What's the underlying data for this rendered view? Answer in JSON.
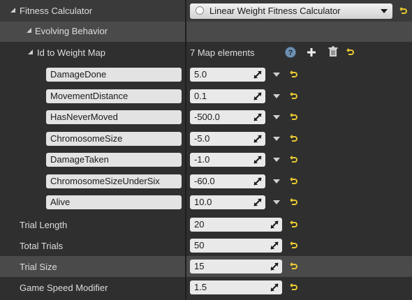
{
  "fitness_calculator": {
    "label": "Fitness Calculator",
    "selected_value": "Linear Weight Fitness Calculator"
  },
  "evolving_behavior": {
    "label": "Evolving Behavior"
  },
  "weight_map": {
    "label": "Id to Weight Map",
    "count_text": "7 Map elements",
    "entries": [
      {
        "key": "DamageDone",
        "value": "5.0"
      },
      {
        "key": "MovementDistance",
        "value": "0.1"
      },
      {
        "key": "HasNeverMoved",
        "value": "-500.0"
      },
      {
        "key": "ChromosomeSize",
        "value": "-5.0"
      },
      {
        "key": "DamageTaken",
        "value": "-1.0"
      },
      {
        "key": "ChromosomeSizeUnderSix",
        "value": "-60.0"
      },
      {
        "key": "Alive",
        "value": "10.0"
      }
    ]
  },
  "properties": [
    {
      "label": "Trial Length",
      "value": "20"
    },
    {
      "label": "Total Trials",
      "value": "50"
    },
    {
      "label": "Trial Size",
      "value": "15"
    },
    {
      "label": "Game Speed Modifier",
      "value": "1.5"
    }
  ],
  "colors": {
    "reset_icon": "#e8c832",
    "help_icon": "#6e8fb0",
    "panel_bg": "#2f2f2f"
  }
}
